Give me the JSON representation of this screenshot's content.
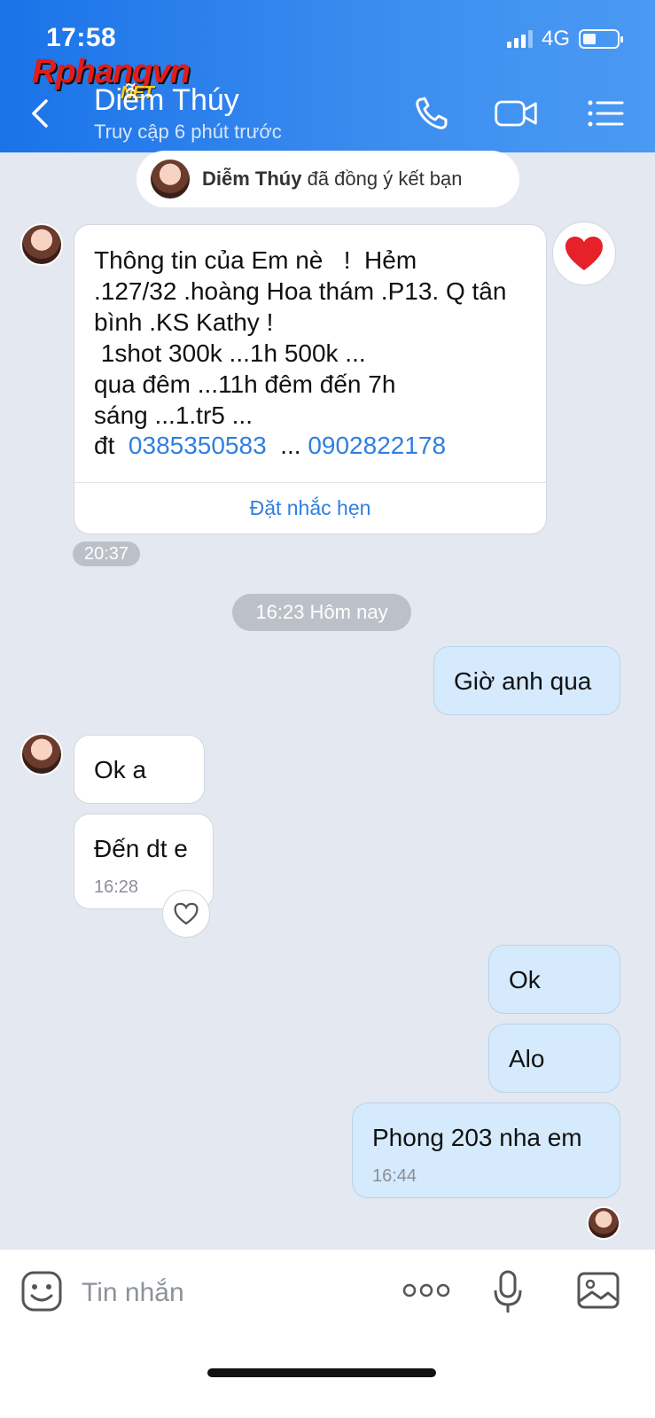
{
  "status_bar": {
    "time": "17:58",
    "network": "4G"
  },
  "watermark": {
    "brand": "Rphangvn",
    "suffix": "NET"
  },
  "header": {
    "contact_name": "Diễm Thúy",
    "last_seen": "Truy cập 6 phút trước",
    "icons": [
      "back-icon",
      "phone-icon",
      "video-call-icon",
      "menu-list-icon"
    ]
  },
  "system_notice": {
    "name": "Diễm Thúy",
    "text": " đã đồng ý kết bạn"
  },
  "card_message": {
    "text_lines": "Thông tin của Em nè   !  Hẻm\n.127/32 .hoàng Hoa thám .P13. Q tân\nbình .KS Kathy !\n 1shot 300k ...1h 500k ...\nqua đêm ...11h đêm đến 7h\nsáng ...1.tr5 ...",
    "phone_prefix": "đt  ",
    "phone_1": "0385350583",
    "phone_separator": "  ... ",
    "phone_2": "0902822178",
    "action_label": "Đặt nhắc hẹn",
    "time": "20:37",
    "reaction": "heart-filled-icon"
  },
  "date_divider": "16:23 Hôm nay",
  "messages": [
    {
      "from": "me",
      "text": "Giờ anh qua"
    },
    {
      "from": "them",
      "text": "Ok a"
    },
    {
      "from": "them",
      "text": "Đến dt e",
      "time": "16:28"
    },
    {
      "from": "me",
      "text": "Ok"
    },
    {
      "from": "me",
      "text": "Alo"
    },
    {
      "from": "me",
      "text": "Phong 203 nha em",
      "time": "16:44"
    }
  ],
  "input": {
    "placeholder": "Tin nhắn"
  },
  "colors": {
    "header_blue": "#1a73e8",
    "my_bubble": "#d5eafc",
    "link": "#2f7fe0",
    "background": "#e4e8f0"
  }
}
